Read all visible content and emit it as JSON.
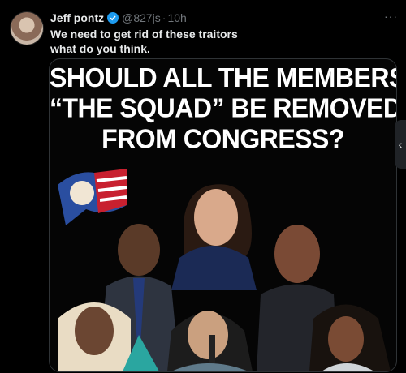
{
  "post": {
    "author_name": "Jeff pontz",
    "handle": "@827js",
    "separator": "·",
    "time": "10h",
    "more_label": "···",
    "text_line1": "We need to get rid of these traitors",
    "text_line2": "what do you think."
  },
  "media": {
    "headline_line1": "SHOULD ALL THE MEMBERS OF",
    "headline_line2": "“THE SQUAD” BE REMOVED",
    "headline_line3": "FROM CONGRESS?"
  },
  "side_panel": {
    "expand_glyph": "‹"
  },
  "colors": {
    "accent": "#1d9bf0",
    "background": "#000000",
    "muted": "#71767b"
  }
}
